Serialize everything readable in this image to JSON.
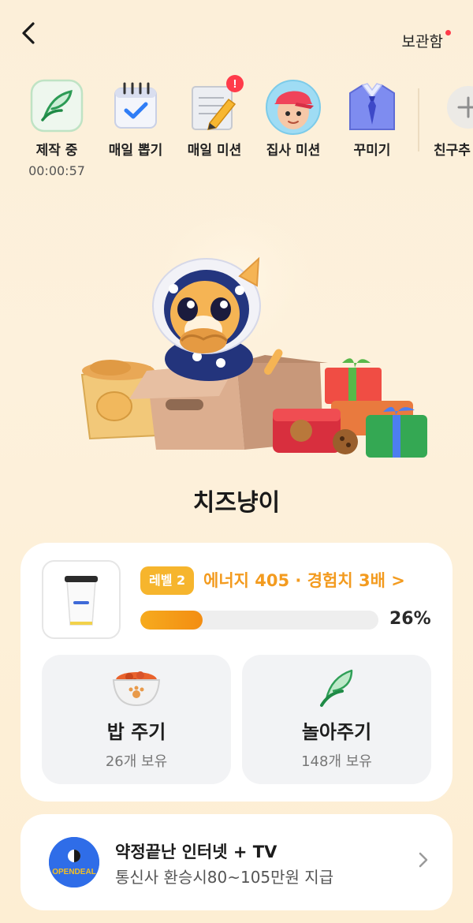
{
  "header": {
    "storage_label": "보관함",
    "storage_has_new": true
  },
  "quick_menu": [
    {
      "label": "제작 중",
      "sub": "00:00:57",
      "icon": "leaf-icon"
    },
    {
      "label": "매일 뽑기",
      "icon": "calendar-check-icon"
    },
    {
      "label": "매일 미션",
      "icon": "notepad-pencil-icon",
      "badge": "!"
    },
    {
      "label": "집사 미션",
      "icon": "boy-avatar-icon"
    },
    {
      "label": "꾸미기",
      "icon": "shirt-tie-icon"
    },
    {
      "label": "친구추",
      "icon": "add-friend-icon"
    }
  ],
  "pet": {
    "name": "치즈냥이"
  },
  "status": {
    "level_label": "레벨 2",
    "energy_text": "에너지 405 · 경험치 3배 >",
    "progress_percent": 26,
    "progress_label": "26%"
  },
  "actions": [
    {
      "label": "밥 주기",
      "sub": "26개 보유",
      "icon": "food-bowl-icon"
    },
    {
      "label": "놀아주기",
      "sub": "148개 보유",
      "icon": "leaf-icon"
    }
  ],
  "ad": {
    "logo_text": "OPENDEAL",
    "title": "약정끝난 인터넷 + TV",
    "subtitle": "통신사 환승시80~105만원 지급"
  },
  "colors": {
    "accent": "#f39b1f",
    "badge": "#f6b52d",
    "alert": "#ff3b4a",
    "background": "#fdf0da"
  }
}
